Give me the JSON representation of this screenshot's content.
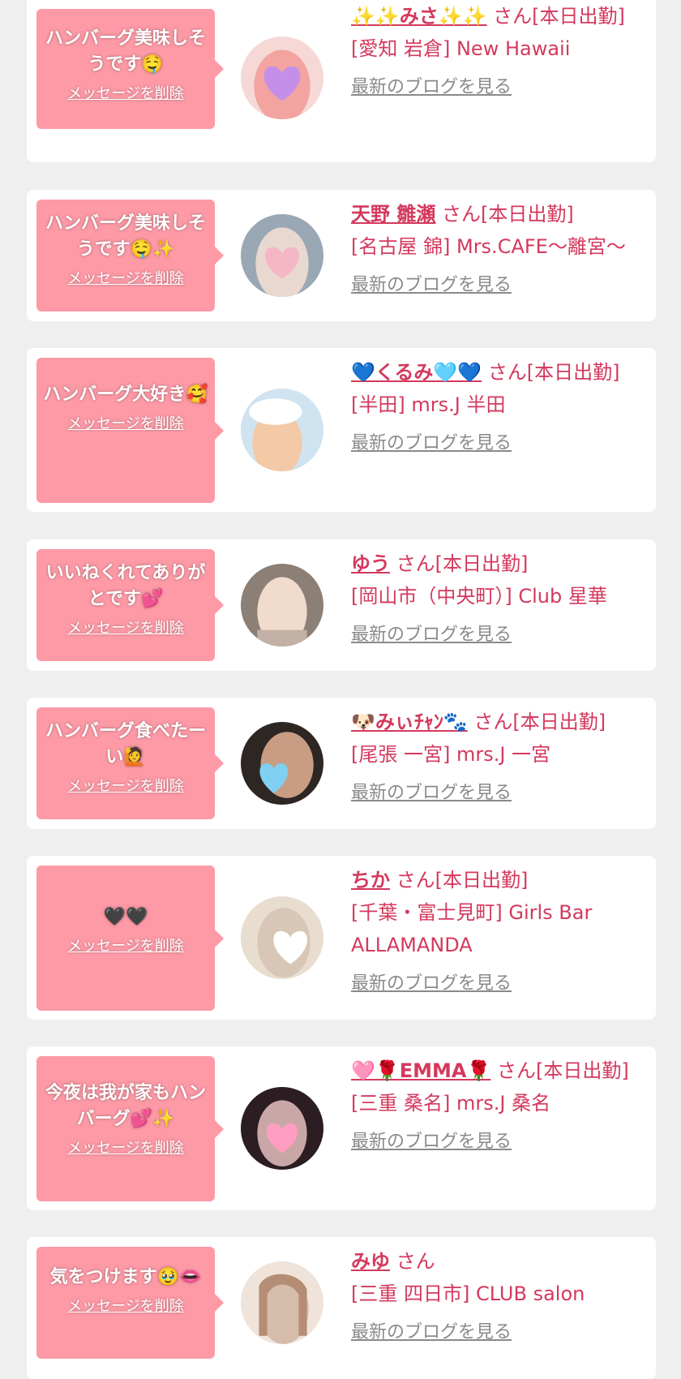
{
  "delete_label": "メッセージを削除",
  "blog_label": "最新のブログを見る",
  "colors": {
    "background": "#efeff0",
    "card": "#ffffff",
    "bubble": "#fd9aa6",
    "accent": "#d4395d",
    "muted_link": "#8a8a8a"
  },
  "messages": [
    {
      "message": "ハンバーグ美味しそうです🤤",
      "name": "✨✨みさ✨✨",
      "status": "さん[本日出勤]",
      "shop": "[愛知 岩倉] New Hawaii",
      "avatar_colors": [
        "#f6d9d6",
        "#f3a4a0",
        "#c48fe9"
      ]
    },
    {
      "message": "ハンバーグ美味しそうです🤤✨",
      "name": "天野 雛瀬",
      "status": "さん[本日出勤]",
      "shop": "[名古屋 錦] Mrs.CAFE〜離宮〜",
      "avatar_colors": [
        "#9aa7b4",
        "#e9d8d0",
        "#f5b6c6"
      ]
    },
    {
      "message": "ハンバーグ大好き🥰",
      "name": "💙くるみ🩵💙",
      "status": "さん[本日出勤]",
      "shop": "[半田] mrs.J 半田",
      "avatar_colors": [
        "#cfe3f0",
        "#f3c9a6",
        "#ffffff"
      ]
    },
    {
      "message": "いいねくれてありがとです💕",
      "name": "ゆう",
      "status": "さん[本日出勤]",
      "shop": "[岡山市（中央町）] Club 星華",
      "avatar_colors": [
        "#8b7f76",
        "#f0dbcc",
        "#c3b1a6"
      ]
    },
    {
      "message": "ハンバーグ食べたーい🙋",
      "name": "🐶みぃﾁｬﾝ🐾",
      "status": "さん[本日出勤]",
      "shop": "[尾張 一宮] mrs.J 一宮",
      "avatar_colors": [
        "#2d2623",
        "#c89d84",
        "#7fd0f1"
      ]
    },
    {
      "message": "🖤🖤",
      "name": "ちか",
      "status": "さん[本日出勤]",
      "shop": "[千葉・富士見町] Girls Bar ALLAMANDA",
      "avatar_colors": [
        "#e8ddcf",
        "#d8c7b6",
        "#ffffff"
      ]
    },
    {
      "message": "今夜は我が家もハンバーグ💕✨",
      "name": "🩷🌹EMMA🌹",
      "status": "さん[本日出勤]",
      "shop": "[三重 桑名] mrs.J 桑名",
      "avatar_colors": [
        "#2b1d22",
        "#c9a7a6",
        "#ff9ec0"
      ]
    },
    {
      "message": "気をつけます🥹👄",
      "name": "みゆ",
      "status": "さん",
      "shop": "[三重 四日市] CLUB salon",
      "avatar_colors": [
        "#efe3da",
        "#d6bcab",
        "#b48d74"
      ]
    }
  ]
}
